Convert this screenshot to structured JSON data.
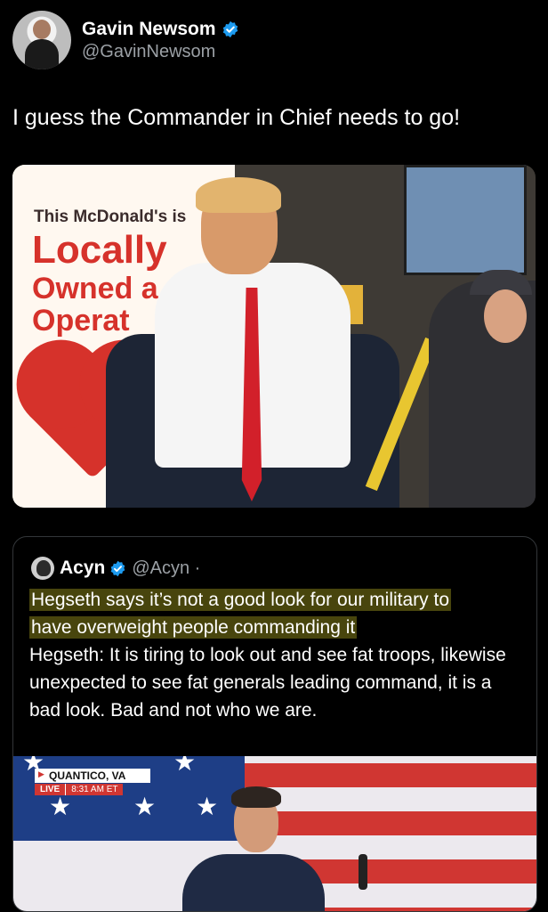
{
  "author": {
    "display_name": "Gavin Newsom",
    "handle": "@GavinNewsom"
  },
  "tweet": {
    "text": "I guess the Commander in Chief needs to go!"
  },
  "media": {
    "sign_line1": "This McDonald's is",
    "sign_line2": "Locally",
    "sign_line3": "Owned a",
    "sign_line4": "Operat"
  },
  "quoted": {
    "display_name": "Acyn",
    "handle": "@Acyn ·",
    "highlight_line1": "Hegseth says it’s not a good look for our military to",
    "highlight_line2": "have overweight people commanding it",
    "body": "Hegseth: It is tiring to look out and see fat troops, likewise unexpected to see fat generals leading command, it is a bad look. Bad and not who we are.",
    "video": {
      "location": "QUANTICO, VA",
      "live_label": "LIVE",
      "time_label": "8:31 AM ET"
    }
  },
  "colors": {
    "verified": "#1d9bf0",
    "highlight": "#dcd228"
  }
}
